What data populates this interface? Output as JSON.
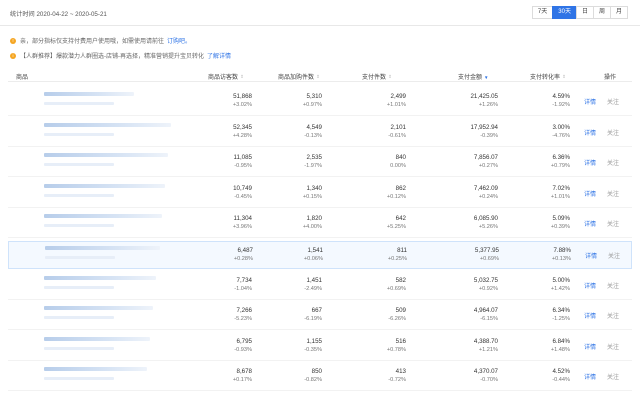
{
  "header": {
    "range_label": "统计时间 2020-04-22 ~ 2020-05-21",
    "range_options": [
      "7天",
      "30天",
      "日",
      "周",
      "月"
    ],
    "active_range": "30天"
  },
  "notices": [
    {
      "text": "亲，部分指标仅支持付费用户使用哦，如需使用请前往",
      "link": "订购吧。"
    },
    {
      "text": "【人群推荐】爆款潜力人群圈选-店铺-再选择，精准营销提升宝贝转化",
      "link": "了解详情"
    }
  ],
  "table": {
    "columns": [
      "商品",
      "商品访客数",
      "商品加购件数",
      "支付件数",
      "支付金额",
      "支付转化率",
      "操作"
    ],
    "rows": [
      {
        "visitors": "51,868",
        "visitors_d": "+3.02%",
        "cart": "5,310",
        "cart_d": "+0.97%",
        "paid_qty": "2,499",
        "paid_qty_d": "+1.01%",
        "amount": "21,425.05",
        "amount_d": "+1.26%",
        "rate": "4.59%",
        "rate_d": "-1.92%"
      },
      {
        "visitors": "52,345",
        "visitors_d": "+4.28%",
        "cart": "4,549",
        "cart_d": "-0.13%",
        "paid_qty": "2,101",
        "paid_qty_d": "-0.61%",
        "amount": "17,952.94",
        "amount_d": "-0.39%",
        "rate": "3.00%",
        "rate_d": "-4.76%"
      },
      {
        "visitors": "11,085",
        "visitors_d": "-0.95%",
        "cart": "2,535",
        "cart_d": "-1.97%",
        "paid_qty": "840",
        "paid_qty_d": "0.00%",
        "amount": "7,856.07",
        "amount_d": "+0.27%",
        "rate": "6.36%",
        "rate_d": "+0.79%"
      },
      {
        "visitors": "10,749",
        "visitors_d": "-0.45%",
        "cart": "1,340",
        "cart_d": "+0.15%",
        "paid_qty": "862",
        "paid_qty_d": "+0.12%",
        "amount": "7,462.09",
        "amount_d": "+0.24%",
        "rate": "7.02%",
        "rate_d": "+1.01%"
      },
      {
        "visitors": "11,304",
        "visitors_d": "+3.96%",
        "cart": "1,820",
        "cart_d": "+4.00%",
        "paid_qty": "642",
        "paid_qty_d": "+5.25%",
        "amount": "6,085.90",
        "amount_d": "+5.26%",
        "rate": "5.09%",
        "rate_d": "+0.39%"
      },
      {
        "visitors": "6,487",
        "visitors_d": "+0.28%",
        "cart": "1,541",
        "cart_d": "+0.06%",
        "paid_qty": "811",
        "paid_qty_d": "+0.25%",
        "amount": "5,377.95",
        "amount_d": "+0.69%",
        "rate": "7.88%",
        "rate_d": "+0.13%"
      },
      {
        "visitors": "7,734",
        "visitors_d": "-1.04%",
        "cart": "1,451",
        "cart_d": "-2.49%",
        "paid_qty": "582",
        "paid_qty_d": "+0.69%",
        "amount": "5,032.75",
        "amount_d": "+0.92%",
        "rate": "5.00%",
        "rate_d": "+1.42%"
      },
      {
        "visitors": "7,266",
        "visitors_d": "-5.23%",
        "cart": "667",
        "cart_d": "-6.19%",
        "paid_qty": "509",
        "paid_qty_d": "-6.26%",
        "amount": "4,964.07",
        "amount_d": "-6.15%",
        "rate": "6.34%",
        "rate_d": "-1.25%"
      },
      {
        "visitors": "6,795",
        "visitors_d": "-0.93%",
        "cart": "1,155",
        "cart_d": "-0.35%",
        "paid_qty": "516",
        "paid_qty_d": "+0.78%",
        "amount": "4,388.70",
        "amount_d": "+1.21%",
        "rate": "6.84%",
        "rate_d": "+1.48%"
      },
      {
        "visitors": "8,678",
        "visitors_d": "+0.17%",
        "cart": "850",
        "cart_d": "-0.82%",
        "paid_qty": "413",
        "paid_qty_d": "-0.72%",
        "amount": "4,370.07",
        "amount_d": "-0.70%",
        "rate": "4.52%",
        "rate_d": "-0.44%"
      }
    ],
    "action_detail": "详情",
    "action_follow": "关注"
  }
}
